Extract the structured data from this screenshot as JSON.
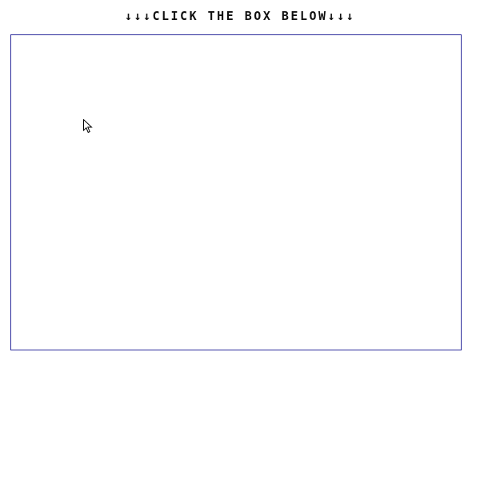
{
  "instruction": {
    "text": "↓↓↓CLICK THE BOX BELOW↓↓↓"
  },
  "click_box": {
    "border_color": "#2a2a9a",
    "background_color": "#ffffff"
  },
  "cursor": {
    "icon": "mouse-pointer-icon"
  }
}
